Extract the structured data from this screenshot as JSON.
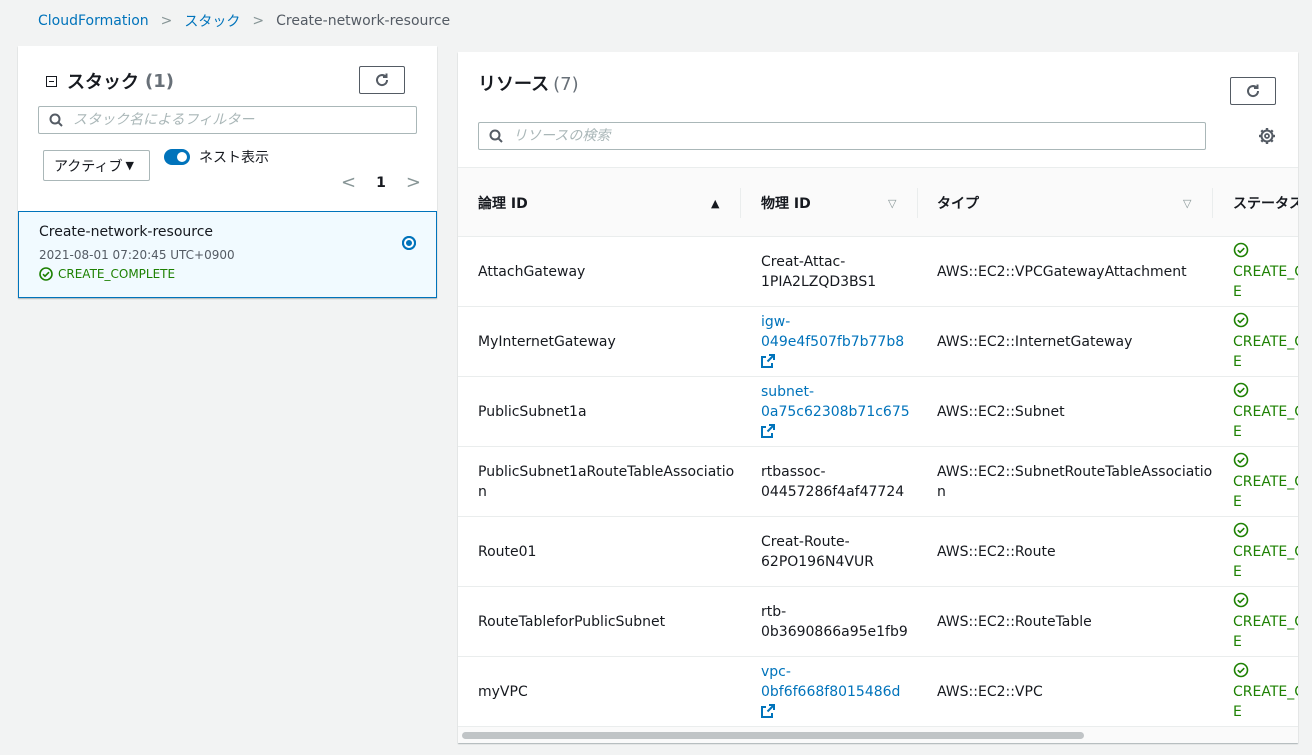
{
  "breadcrumb": {
    "root": "CloudFormation",
    "stacks": "スタック",
    "current": "Create-network-resource"
  },
  "stacks_panel": {
    "title": "スタック",
    "count": "(1)",
    "search_placeholder": "スタック名によるフィルター",
    "filter_select": "アクティブ",
    "nested_toggle_label": "ネスト表示",
    "page": "1",
    "stack": {
      "name": "Create-network-resource",
      "date": "2021-08-01 07:20:45 UTC+0900",
      "status": "CREATE_COMPLETE"
    }
  },
  "resources_panel": {
    "title": "リソース",
    "count": "(7)",
    "search_placeholder": "リソースの検索",
    "columns": {
      "logical": "論理 ID",
      "physical": "物理 ID",
      "type": "タイプ",
      "status": "ステータス"
    },
    "rows": [
      {
        "logical": [
          "AttachGateway"
        ],
        "physical": [
          "Creat-Attac-",
          "1PIA2LZQD3BS1"
        ],
        "link": false,
        "type": [
          "AWS::EC2::VPCGatewayAttachment"
        ],
        "status": [
          "CREATE_C",
          "E"
        ]
      },
      {
        "logical": [
          "MyInternetGateway"
        ],
        "physical": [
          "igw-",
          "049e4f507fb7b77b8"
        ],
        "link": true,
        "type": [
          "AWS::EC2::InternetGateway"
        ],
        "status": [
          "CREATE_C",
          "E"
        ]
      },
      {
        "logical": [
          "PublicSubnet1a"
        ],
        "physical": [
          "subnet-",
          "0a75c62308b71c675"
        ],
        "link": true,
        "type": [
          "AWS::EC2::Subnet"
        ],
        "status": [
          "CREATE_C",
          "E"
        ]
      },
      {
        "logical": [
          "PublicSubnet1aRouteTableAssociatio",
          "n"
        ],
        "physical": [
          "rtbassoc-",
          "04457286f4af47724"
        ],
        "link": false,
        "type": [
          "AWS::EC2::SubnetRouteTableAssociatio",
          "n"
        ],
        "status": [
          "CREATE_C",
          "E"
        ]
      },
      {
        "logical": [
          "Route01"
        ],
        "physical": [
          "Creat-Route-",
          "62PO196N4VUR"
        ],
        "link": false,
        "type": [
          "AWS::EC2::Route"
        ],
        "status": [
          "CREATE_C",
          "E"
        ]
      },
      {
        "logical": [
          "RouteTableforPublicSubnet"
        ],
        "physical": [
          "rtb-",
          "0b3690866a95e1fb9"
        ],
        "link": false,
        "type": [
          "AWS::EC2::RouteTable"
        ],
        "status": [
          "CREATE_C",
          "E"
        ]
      },
      {
        "logical": [
          "myVPC"
        ],
        "physical": [
          "vpc-",
          "0bf6f668f8015486d"
        ],
        "link": true,
        "type": [
          "AWS::EC2::VPC"
        ],
        "status": [
          "CREATE_C",
          "E"
        ]
      }
    ]
  },
  "colors": {
    "link": "#0073bb",
    "success": "#1d8102",
    "selected_bg": "#f1faff",
    "page_bg": "#f2f3f3"
  }
}
